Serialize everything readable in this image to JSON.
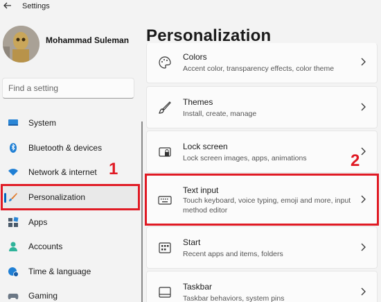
{
  "window": {
    "app_title": "Settings"
  },
  "user": {
    "name": "Mohammad Suleman"
  },
  "search": {
    "placeholder": "Find a setting"
  },
  "sidebar": {
    "items": [
      {
        "label": "System",
        "icon": "monitor-icon"
      },
      {
        "label": "Bluetooth & devices",
        "icon": "bluetooth-icon"
      },
      {
        "label": "Network & internet",
        "icon": "wifi-icon"
      },
      {
        "label": "Personalization",
        "icon": "brush-icon",
        "selected": true
      },
      {
        "label": "Apps",
        "icon": "apps-icon"
      },
      {
        "label": "Accounts",
        "icon": "person-icon"
      },
      {
        "label": "Time & language",
        "icon": "globe-clock-icon"
      },
      {
        "label": "Gaming",
        "icon": "gamepad-icon"
      }
    ]
  },
  "main": {
    "title": "Personalization",
    "cards": [
      {
        "title": "Colors",
        "subtitle": "Accent color, transparency effects, color theme",
        "icon": "palette-icon"
      },
      {
        "title": "Themes",
        "subtitle": "Install, create, manage",
        "icon": "brush-icon"
      },
      {
        "title": "Lock screen",
        "subtitle": "Lock screen images, apps, animations",
        "icon": "lock-screen-icon"
      },
      {
        "title": "Text input",
        "subtitle": "Touch keyboard, voice typing, emoji and more, input method editor",
        "icon": "keyboard-icon"
      },
      {
        "title": "Start",
        "subtitle": "Recent apps and items, folders",
        "icon": "start-icon"
      },
      {
        "title": "Taskbar",
        "subtitle": "Taskbar behaviors, system pins",
        "icon": "taskbar-icon"
      }
    ]
  },
  "annotations": {
    "marker_1": "1",
    "marker_2": "2"
  },
  "colors": {
    "accent": "#0067c0",
    "highlight": "#e01a24",
    "background": "#f3f3f3",
    "card": "#fbfbfb"
  }
}
